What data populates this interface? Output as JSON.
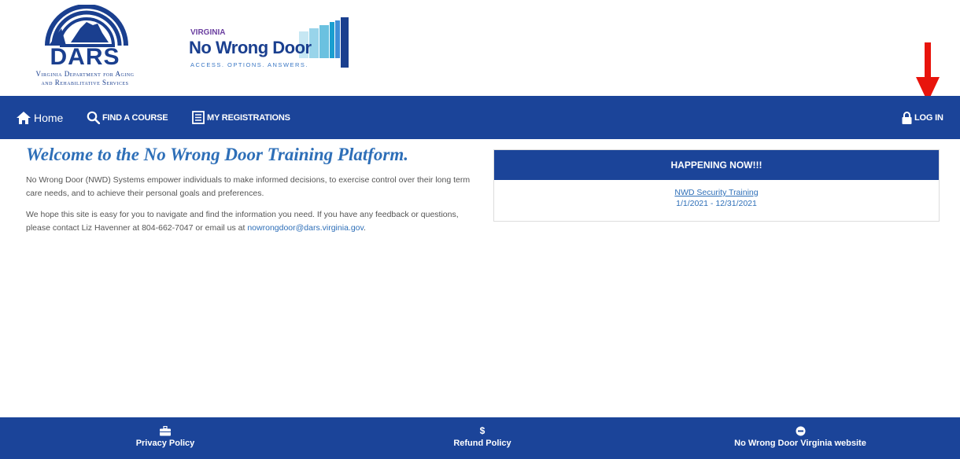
{
  "header": {
    "dars_logo": {
      "word": "DARS",
      "line1": "Virginia Department for Aging",
      "line2": "and Rehabilitative Services"
    },
    "nwd_logo": {
      "state": "VIRGINIA",
      "title": "No Wrong Door",
      "tagline": "ACCESS. OPTIONS. ANSWERS."
    }
  },
  "nav": {
    "home": "Home",
    "find_course": "FIND A COURSE",
    "my_registrations": "MY REGISTRATIONS",
    "login": "LOG IN"
  },
  "main": {
    "welcome": "Welcome to the No Wrong Door Training Platform.",
    "para1": "No Wrong Door (NWD) Systems empower individuals to make informed decisions, to exercise control over their long term care needs, and to achieve their personal goals and preferences.",
    "para2_text": "We hope this site is easy for you to navigate and find the information you need. If you have any feedback or questions, please contact Liz Havenner at 804-662-7047 or email us at ",
    "para2_email": "nowrongdoor@dars.virginia.gov",
    "para2_end": "."
  },
  "happening": {
    "heading": "HAPPENING NOW!!!",
    "event_title": "NWD Security Training",
    "event_dates": "1/1/2021 - 12/31/2021"
  },
  "footer": {
    "privacy": "Privacy Policy",
    "refund": "Refund Policy",
    "refund_icon": "$",
    "nwd_site": "No Wrong Door Virginia website"
  },
  "colors": {
    "nav_blue": "#1b4499",
    "link_blue": "#2e6fb8",
    "annotation_red": "#e8140c"
  },
  "icons": [
    "home-icon",
    "search-icon",
    "list-icon",
    "lock-icon",
    "briefcase-icon",
    "dollar-icon",
    "circle-icon",
    "red-arrow-annotation"
  ]
}
